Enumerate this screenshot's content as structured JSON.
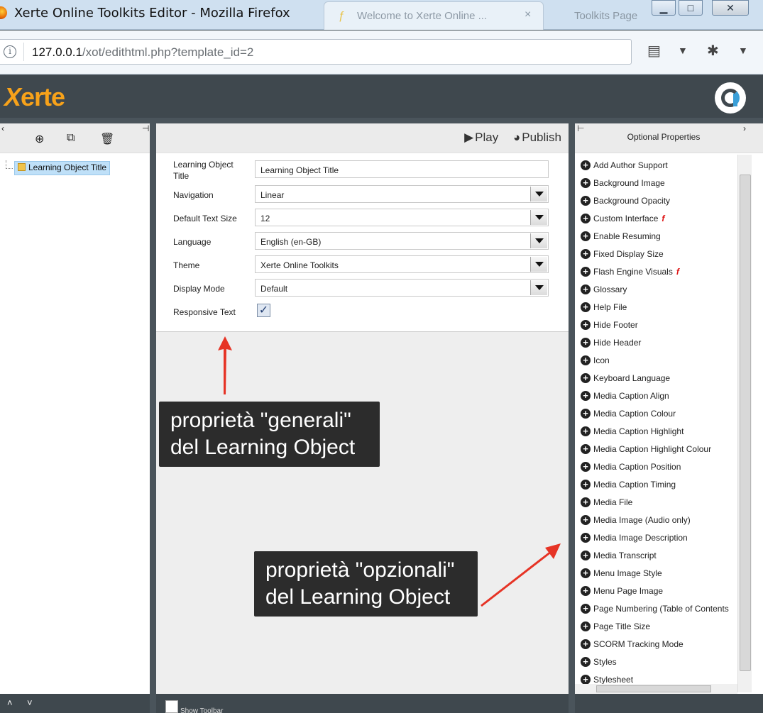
{
  "browser": {
    "window_title": "Xerte Online Toolkits Editor - Mozilla Firefox",
    "tabs": [
      {
        "label": "Welcome to Xerte Online ..."
      },
      {
        "label": "Toolkits Page"
      }
    ],
    "url_host": "127.0.0.1",
    "url_path": "/xot/edithtml.php?template_id=2"
  },
  "app": {
    "logo_text": "erte",
    "logo_x": "X"
  },
  "left_panel": {
    "tree_item": "Learning Object Title"
  },
  "center_panel": {
    "play_label": "Play",
    "publish_label": "Publish",
    "fields": [
      {
        "label": "Learning Object Title",
        "value": "Learning Object Title"
      },
      {
        "label": "Navigation",
        "value": "Linear"
      },
      {
        "label": "Default Text Size",
        "value": "12"
      },
      {
        "label": "Language",
        "value": "English (en-GB)"
      },
      {
        "label": "Theme",
        "value": "Xerte Online Toolkits"
      },
      {
        "label": "Display Mode",
        "value": "Default"
      },
      {
        "label": "Responsive Text",
        "value": "✓"
      }
    ],
    "show_toolbar": "Show Toolbar"
  },
  "right_panel": {
    "title": "Optional Properties",
    "items": [
      "Add Author Support",
      "Background Image",
      "Background Opacity",
      "Custom Interface",
      "Enable Resuming",
      "Fixed Display Size",
      "Flash Engine Visuals",
      "Glossary",
      "Help File",
      "Hide Footer",
      "Hide Header",
      "Icon",
      "Keyboard Language",
      "Media Caption Align",
      "Media Caption Colour",
      "Media Caption Highlight",
      "Media Caption Highlight Colour",
      "Media Caption Position",
      "Media Caption Timing",
      "Media File",
      "Media Image (Audio only)",
      "Media Image Description",
      "Media Transcript",
      "Menu Image Style",
      "Menu Page Image",
      "Page Numbering (Table of Contents",
      "Page Title Size",
      "SCORM Tracking Mode",
      "Styles",
      "Stylesheet"
    ],
    "flash_marker": "f"
  },
  "annotations": {
    "general_line1": "proprietà \"generali\"",
    "general_line2": "del Learning Object",
    "optional_line1": "proprietà \"opzionali\"",
    "optional_line2": "del Learning Object"
  },
  "colors": {
    "accent_red": "#e63325",
    "logo_orange": "#f7a21a",
    "header_bg": "#3f484e"
  }
}
